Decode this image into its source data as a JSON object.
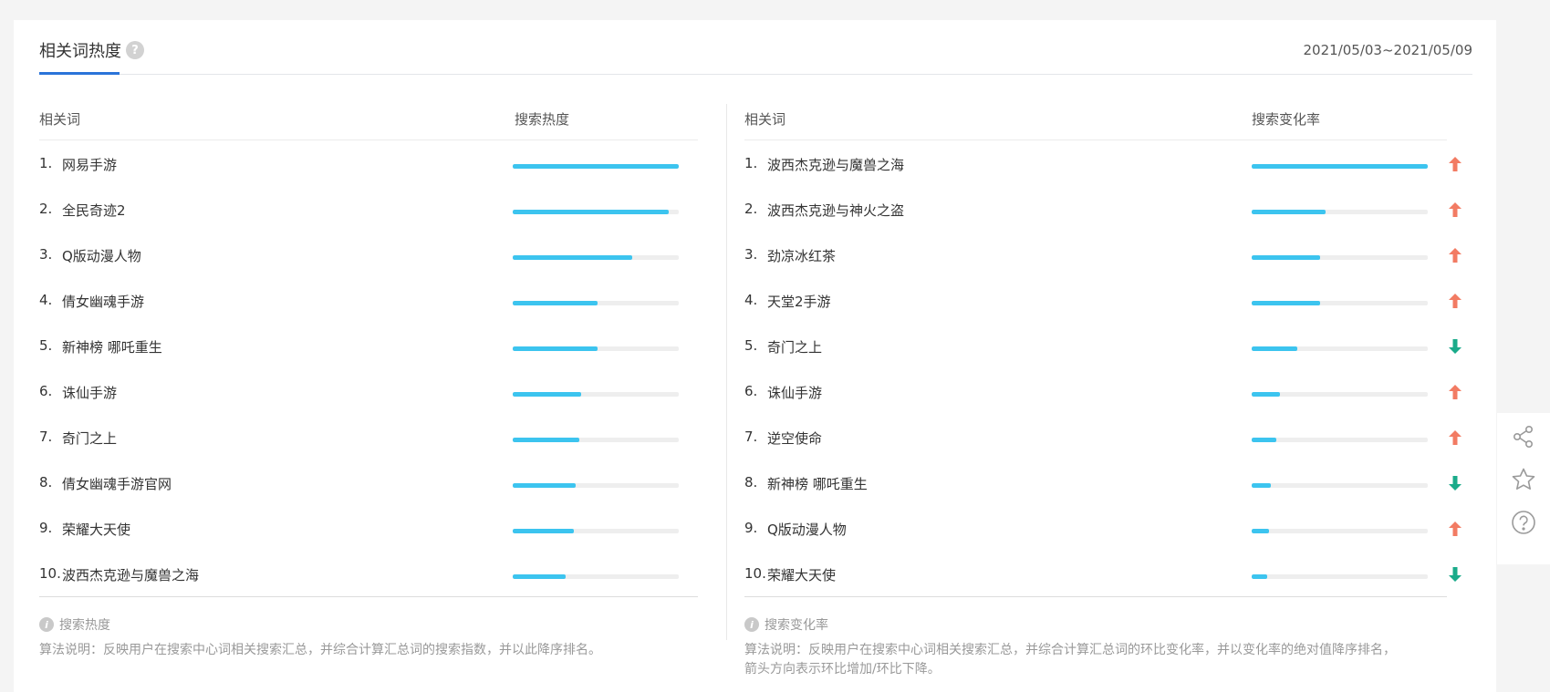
{
  "header": {
    "title": "相关词热度",
    "help_icon": "question-icon",
    "date_range": "2021/05/03~2021/05/09"
  },
  "left": {
    "col_term": "相关词",
    "col_metric": "搜索热度",
    "rows": [
      {
        "index": "1.",
        "term": "网易手游",
        "value": 100
      },
      {
        "index": "2.",
        "term": "全民奇迹2",
        "value": 94
      },
      {
        "index": "3.",
        "term": "Q版动漫人物",
        "value": 72
      },
      {
        "index": "4.",
        "term": "倩女幽魂手游",
        "value": 51
      },
      {
        "index": "5.",
        "term": "新神榜 哪吒重生",
        "value": 51
      },
      {
        "index": "6.",
        "term": "诛仙手游",
        "value": 41
      },
      {
        "index": "7.",
        "term": "奇门之上",
        "value": 40
      },
      {
        "index": "8.",
        "term": "倩女幽魂手游官网",
        "value": 38
      },
      {
        "index": "9.",
        "term": "荣耀大天使",
        "value": 37
      },
      {
        "index": "10.",
        "term": "波西杰克逊与魔兽之海",
        "value": 32
      }
    ],
    "note_title": "搜索热度",
    "note_text": "算法说明：反映用户在搜索中心词相关搜索汇总，并综合计算汇总词的搜索指数，并以此降序排名。"
  },
  "right": {
    "col_term": "相关词",
    "col_metric": "搜索变化率",
    "rows": [
      {
        "index": "1.",
        "term": "波西杰克逊与魔兽之海",
        "value": 100,
        "direction": "up"
      },
      {
        "index": "2.",
        "term": "波西杰克逊与神火之盗",
        "value": 42,
        "direction": "up"
      },
      {
        "index": "3.",
        "term": "劲凉冰红茶",
        "value": 39,
        "direction": "up"
      },
      {
        "index": "4.",
        "term": "天堂2手游",
        "value": 39,
        "direction": "up"
      },
      {
        "index": "5.",
        "term": "奇门之上",
        "value": 26,
        "direction": "down"
      },
      {
        "index": "6.",
        "term": "诛仙手游",
        "value": 16,
        "direction": "up"
      },
      {
        "index": "7.",
        "term": "逆空使命",
        "value": 14,
        "direction": "up"
      },
      {
        "index": "8.",
        "term": "新神榜 哪吒重生",
        "value": 11,
        "direction": "down"
      },
      {
        "index": "9.",
        "term": "Q版动漫人物",
        "value": 10,
        "direction": "up"
      },
      {
        "index": "10.",
        "term": "荣耀大天使",
        "value": 9,
        "direction": "down"
      }
    ],
    "note_title": "搜索变化率",
    "note_text": "算法说明：反映用户在搜索中心词相关搜索汇总，并综合计算汇总词的环比变化率，并以变化率的绝对值降序排名，",
    "note_text2": "箭头方向表示环比增加/环比下降。"
  },
  "colors": {
    "bar": "#3cc4ef",
    "up": "#f27b63",
    "down": "#1aab8a",
    "accent": "#2a74d9"
  },
  "toolbar": {
    "icons": [
      "share-icon",
      "star-icon",
      "help-icon"
    ]
  }
}
